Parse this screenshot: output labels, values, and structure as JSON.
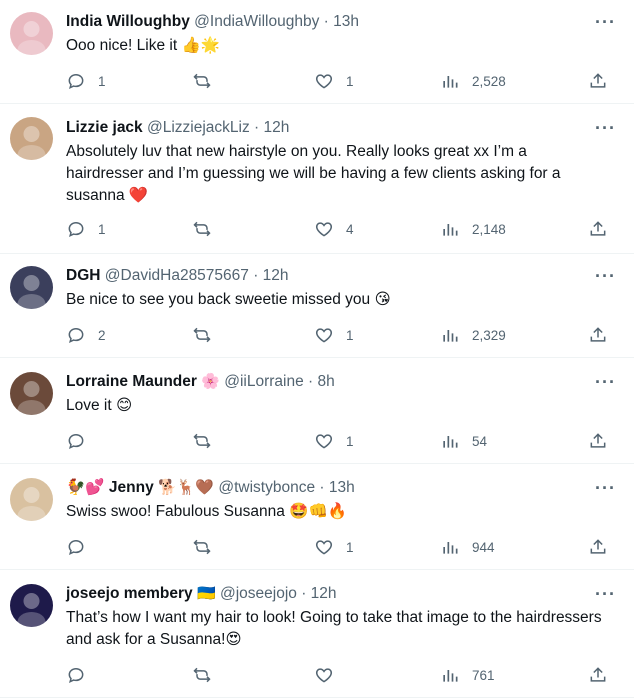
{
  "more_label": "···",
  "tweets": [
    {
      "name": "India Willoughby",
      "name_emoji": "",
      "handle": "@IndiaWilloughby",
      "time": " · 13h",
      "text": "Ooo nice! Like it 👍🌟",
      "reply_count": "1",
      "retweet_count": "",
      "like_count": "1",
      "view_count": "2,528",
      "avatar_color": "#e9b9c0"
    },
    {
      "name": "Lizzie jack",
      "name_emoji": "",
      "handle": "@LizziejackLiz",
      "time": " · 12h",
      "text": "Absolutely luv that new hairstyle on you. Really looks great xx I’m a hairdresser and I’m guessing we will be having a few clients asking for a susanna ❤️",
      "reply_count": "1",
      "retweet_count": "",
      "like_count": "4",
      "view_count": "2,148",
      "avatar_color": "#c9a583"
    },
    {
      "name": "DGH",
      "name_emoji": "",
      "handle": "@DavidHa28575667",
      "time": " · 12h",
      "text": "Be nice to see you back sweetie missed you 😘",
      "reply_count": "2",
      "retweet_count": "",
      "like_count": "1",
      "view_count": "2,329",
      "avatar_color": "#3b3f5c"
    },
    {
      "name": "Lorraine Maunder",
      "name_emoji": "🌸",
      "handle": "@iiLorraine",
      "time": " · 8h",
      "text": "Love it 😊",
      "reply_count": "",
      "retweet_count": "",
      "like_count": "1",
      "view_count": "54",
      "avatar_color": "#6b4a3a"
    },
    {
      "name": "🐓💕 Jenny",
      "name_emoji": "🐕🦌🤎",
      "handle": "@twistybonce",
      "time": " · 13h",
      "text": "Swiss swoo! Fabulous Susanna 🤩👊🔥",
      "reply_count": "",
      "retweet_count": "",
      "like_count": "1",
      "view_count": "944",
      "avatar_color": "#d9c1a0"
    },
    {
      "name": "joseejo membery",
      "name_emoji": "🇺🇦",
      "handle": "@joseejojo",
      "time": " · 12h",
      "text": "That’s how I want my hair to look! Going to take that image to the hairdressers and ask for a Susanna!😍",
      "reply_count": "",
      "retweet_count": "",
      "like_count": "",
      "view_count": "761",
      "avatar_color": "#1e1a4a"
    }
  ]
}
